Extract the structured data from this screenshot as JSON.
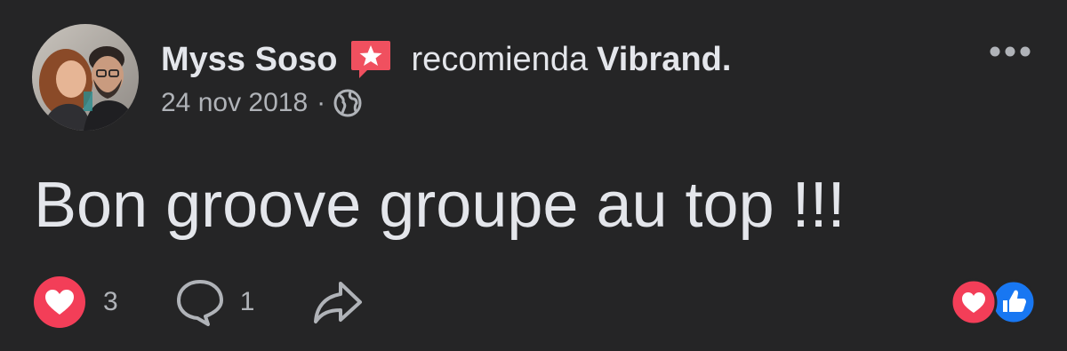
{
  "post": {
    "author": "Myss Soso",
    "verb": "recomienda",
    "page": "Vibrand.",
    "date": "24 nov 2018",
    "separator": "·",
    "text": "Bon groove groupe au top !!!"
  },
  "footer": {
    "like_count": "3",
    "comment_count": "1"
  },
  "icons": {
    "recommend": "recommend-star-icon",
    "privacy": "globe-icon",
    "more": "more-horizontal-icon",
    "love": "heart-icon",
    "comment": "comment-icon",
    "share": "share-icon",
    "summary_love": "heart-reaction-icon",
    "summary_like": "thumbs-up-reaction-icon"
  },
  "colors": {
    "background": "#252526",
    "primary_text": "#e4e6eb",
    "secondary_text": "#b0b3b8",
    "recommend_red": "#f0505f",
    "love_red": "#f33e58",
    "like_blue": "#1877f2"
  }
}
